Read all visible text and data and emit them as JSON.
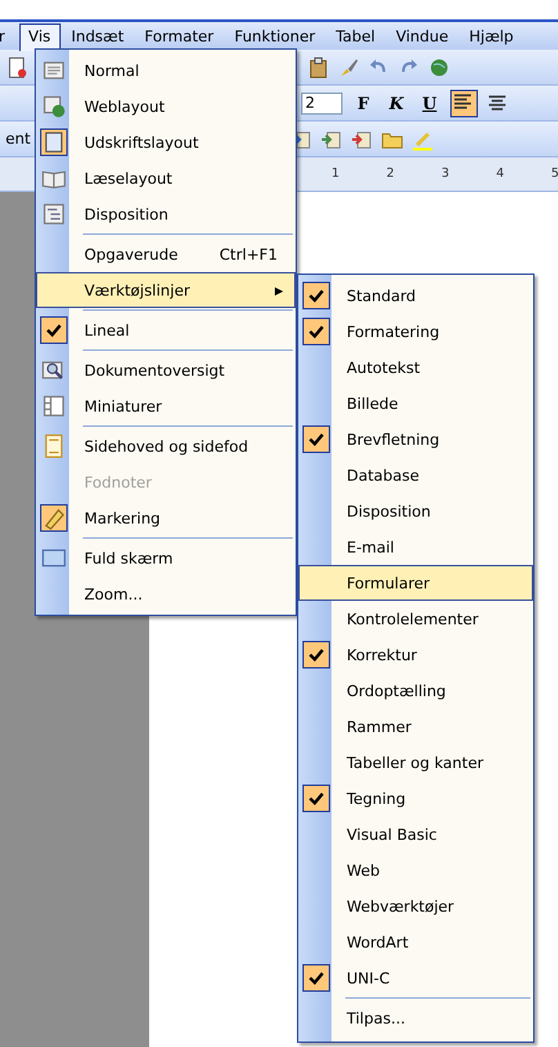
{
  "menu_bar": [
    {
      "label": "r",
      "selected": false
    },
    {
      "label": "Vis",
      "selected": true
    },
    {
      "label": "Indsæt",
      "selected": false
    },
    {
      "label": "Formater",
      "selected": false
    },
    {
      "label": "Funktioner",
      "selected": false
    },
    {
      "label": "Tabel",
      "selected": false
    },
    {
      "label": "Vindue",
      "selected": false
    },
    {
      "label": "Hjælp",
      "selected": false
    }
  ],
  "toolbar": {
    "left_text": "ent",
    "font_size": "2",
    "format_buttons": [
      {
        "label": "F",
        "kind": "bold"
      },
      {
        "label": "K",
        "kind": "italic"
      },
      {
        "label": "U",
        "kind": "underline"
      }
    ],
    "ruler_labels": [
      "1",
      "2",
      "3",
      "4",
      "5"
    ]
  },
  "view_menu": {
    "groups": [
      {
        "items": [
          {
            "label": "Normal",
            "kind": "icon",
            "checked": false,
            "disabled": false,
            "selected": false
          },
          {
            "label": "Weblayout",
            "kind": "icon",
            "checked": false,
            "disabled": false,
            "selected": false
          },
          {
            "label": "Udskriftslayout",
            "kind": "icon",
            "checked": true,
            "disabled": false,
            "selected": false
          },
          {
            "label": "Læselayout",
            "kind": "icon",
            "checked": false,
            "disabled": false,
            "selected": false
          },
          {
            "label": "Disposition",
            "kind": "icon",
            "checked": false,
            "disabled": false,
            "selected": false
          }
        ]
      },
      {
        "items": [
          {
            "label": "Opgaverude",
            "shortcut": "Ctrl+F1",
            "kind": "plain",
            "checked": false,
            "disabled": false,
            "selected": false
          },
          {
            "label": "Værktøjslinjer",
            "kind": "submenu",
            "checked": false,
            "disabled": false,
            "selected": true
          }
        ]
      },
      {
        "items": [
          {
            "label": "Lineal",
            "kind": "plain",
            "checked": true,
            "disabled": false,
            "selected": false
          }
        ]
      },
      {
        "items": [
          {
            "label": "Dokumentoversigt",
            "kind": "icon",
            "checked": false,
            "disabled": false,
            "selected": false
          },
          {
            "label": "Miniaturer",
            "kind": "icon",
            "checked": false,
            "disabled": false,
            "selected": false
          }
        ]
      },
      {
        "items": [
          {
            "label": "Sidehoved og sidefod",
            "kind": "icon",
            "checked": false,
            "disabled": false,
            "selected": false
          },
          {
            "label": "Fodnoter",
            "kind": "plain",
            "checked": false,
            "disabled": true,
            "selected": false
          },
          {
            "label": "Markering",
            "kind": "icon",
            "checked": true,
            "disabled": false,
            "selected": false
          }
        ]
      },
      {
        "items": [
          {
            "label": "Fuld skærm",
            "kind": "icon",
            "checked": false,
            "disabled": false,
            "selected": false
          },
          {
            "label": "Zoom...",
            "kind": "plain",
            "checked": false,
            "disabled": false,
            "selected": false
          }
        ]
      }
    ]
  },
  "toolbars_submenu": {
    "groups": [
      {
        "items": [
          {
            "label": "Standard",
            "checked": true,
            "selected": false
          },
          {
            "label": "Formatering",
            "checked": true,
            "selected": false
          },
          {
            "label": "Autotekst",
            "checked": false,
            "selected": false
          },
          {
            "label": "Billede",
            "checked": false,
            "selected": false
          },
          {
            "label": "Brevfletning",
            "checked": true,
            "selected": false
          },
          {
            "label": "Database",
            "checked": false,
            "selected": false
          },
          {
            "label": "Disposition",
            "checked": false,
            "selected": false
          },
          {
            "label": "E-mail",
            "checked": false,
            "selected": false
          },
          {
            "label": "Formularer",
            "checked": false,
            "selected": true
          },
          {
            "label": "Kontrolelementer",
            "checked": false,
            "selected": false
          },
          {
            "label": "Korrektur",
            "checked": true,
            "selected": false
          },
          {
            "label": "Ordoptælling",
            "checked": false,
            "selected": false
          },
          {
            "label": "Rammer",
            "checked": false,
            "selected": false
          },
          {
            "label": "Tabeller og kanter",
            "checked": false,
            "selected": false
          },
          {
            "label": "Tegning",
            "checked": true,
            "selected": false
          },
          {
            "label": "Visual Basic",
            "checked": false,
            "selected": false
          },
          {
            "label": "Web",
            "checked": false,
            "selected": false
          },
          {
            "label": "Webværktøjer",
            "checked": false,
            "selected": false
          },
          {
            "label": "WordArt",
            "checked": false,
            "selected": false
          },
          {
            "label": "UNI-C",
            "checked": true,
            "selected": false
          }
        ]
      },
      {
        "items": [
          {
            "label": "Tilpas...",
            "checked": false,
            "selected": false
          }
        ]
      }
    ]
  }
}
